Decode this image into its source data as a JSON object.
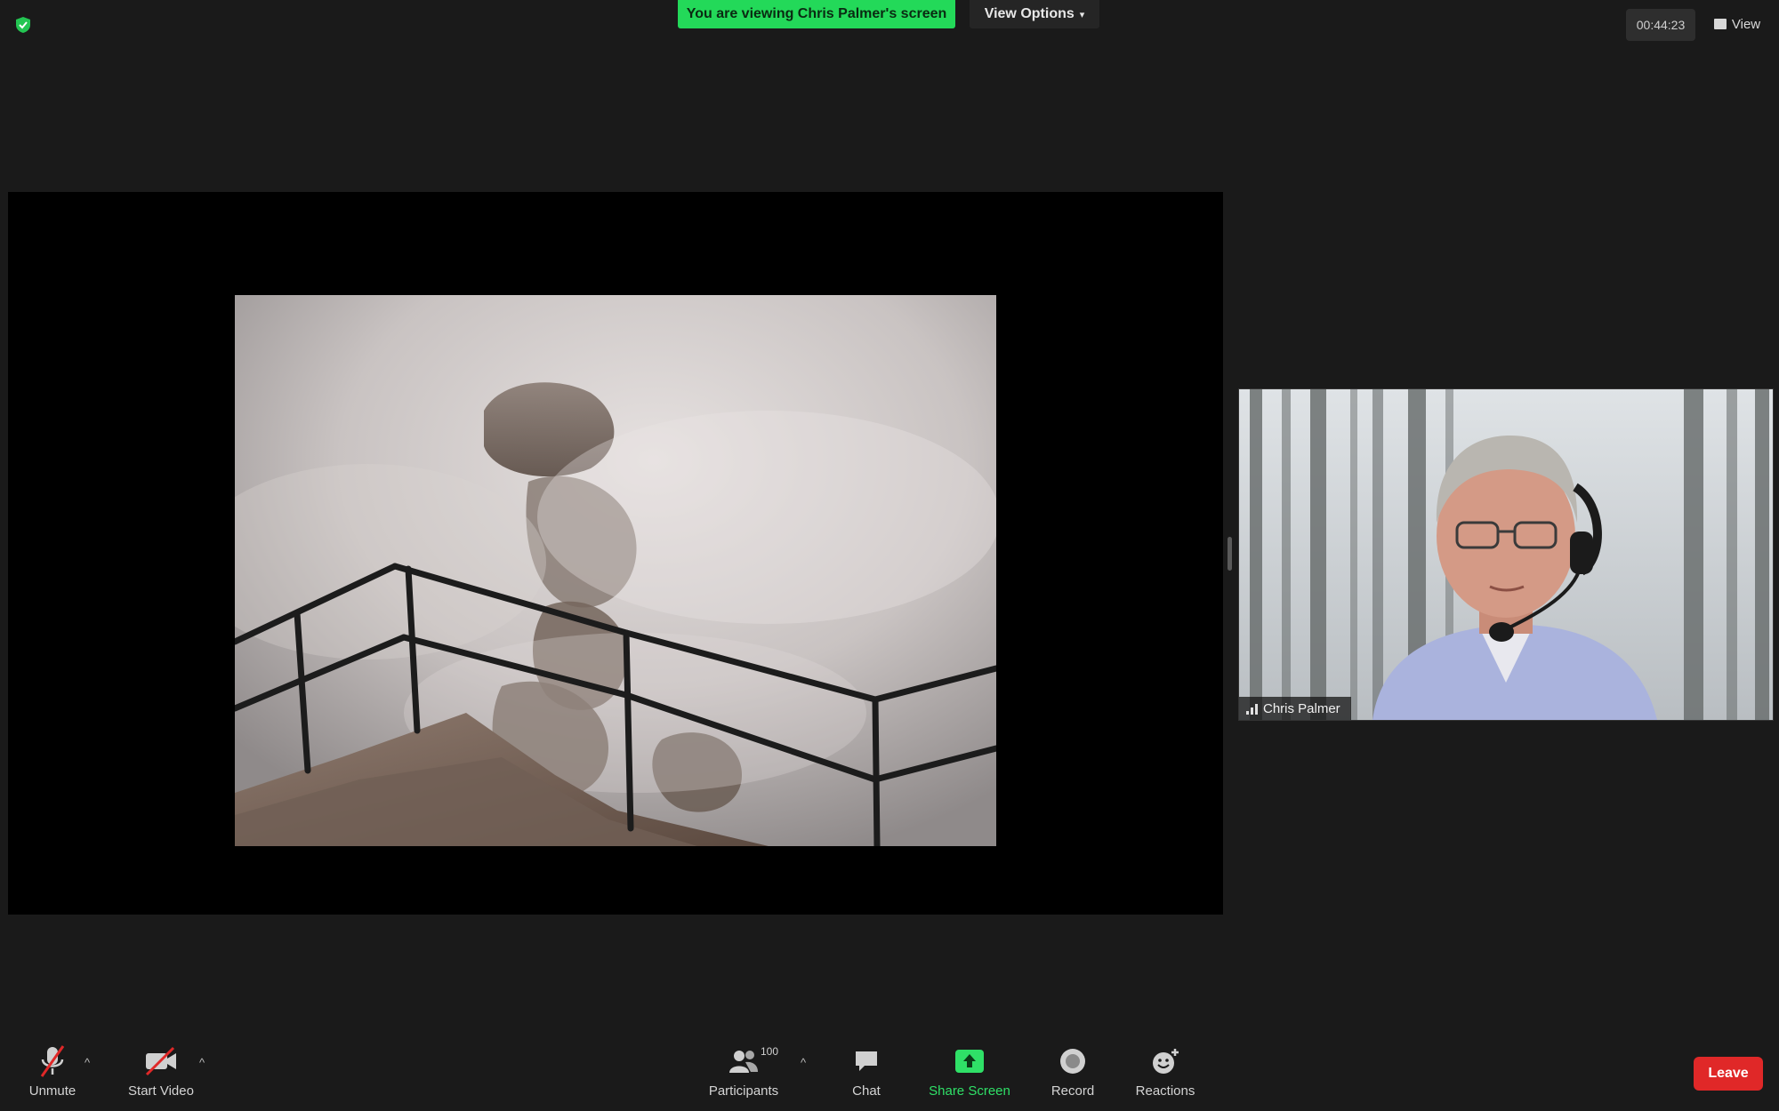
{
  "top_bar": {
    "share_banner": "You are viewing Chris Palmer's screen",
    "view_options_label": "View Options",
    "meeting_timer": "00:44:23",
    "view_label": "View"
  },
  "participant": {
    "name": "Chris Palmer"
  },
  "toolbar": {
    "unmute_label": "Unmute",
    "start_video_label": "Start Video",
    "participants_label": "Participants",
    "participants_count": "100",
    "chat_label": "Chat",
    "share_screen_label": "Share Screen",
    "record_label": "Record",
    "reactions_label": "Reactions",
    "leave_label": "Leave"
  },
  "colors": {
    "background": "#1a1a1a",
    "share_banner_green": "#23d959",
    "share_screen_green": "#2fe067",
    "leave_red": "#e02828"
  },
  "icons": {
    "security": "shield-check-icon",
    "unmute": "microphone-muted-icon",
    "start_video": "video-camera-off-icon",
    "participants": "people-icon",
    "chat": "speech-bubble-icon",
    "share_screen": "share-screen-arrow-icon",
    "record": "record-circle-icon",
    "reactions": "smiley-plus-icon"
  }
}
